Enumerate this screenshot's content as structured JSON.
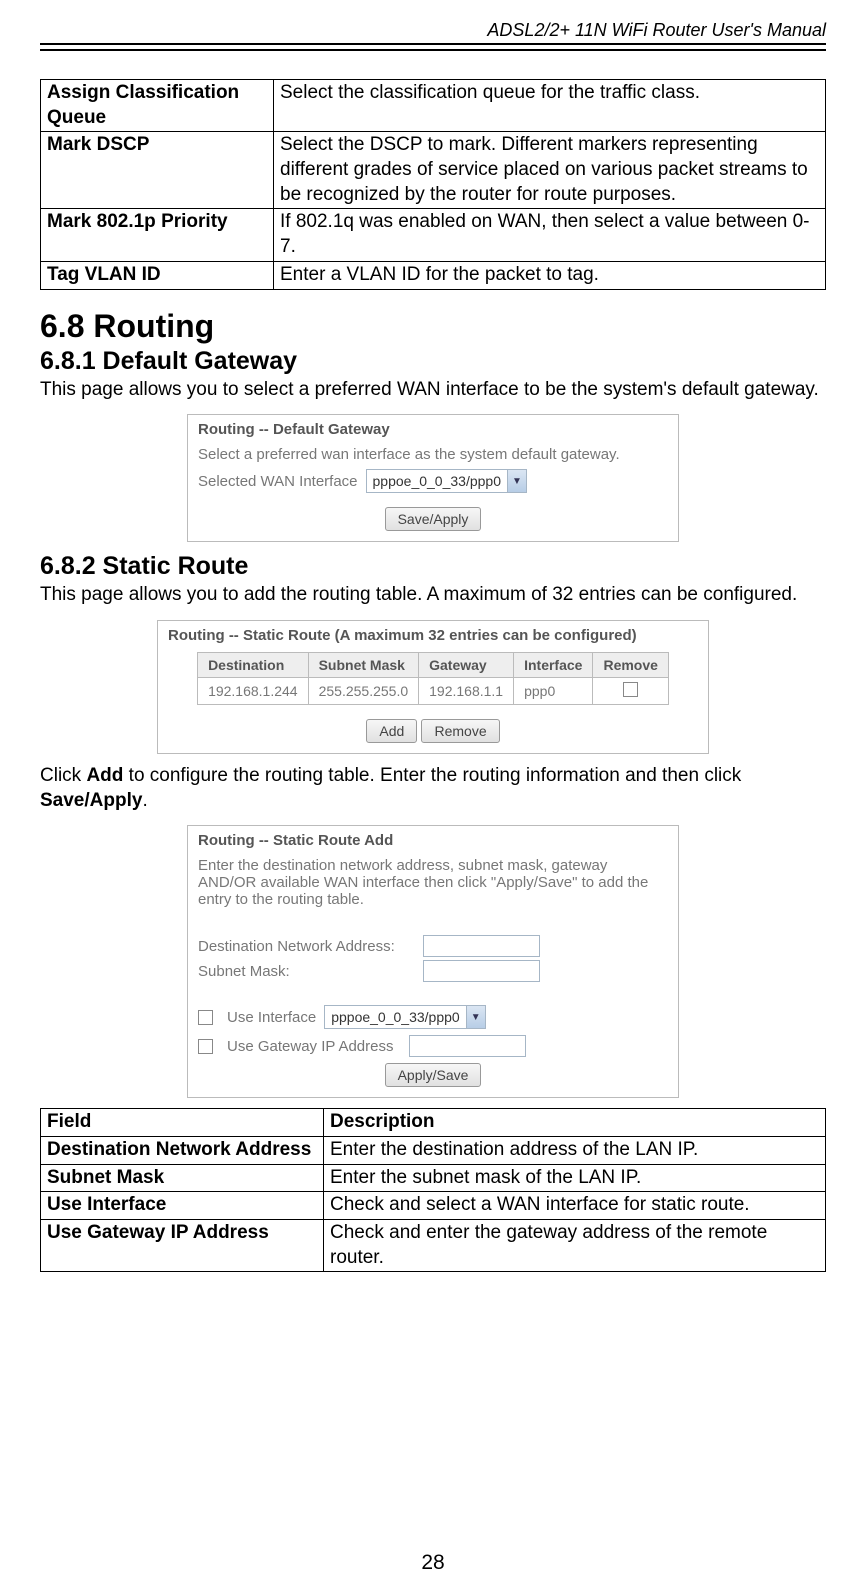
{
  "doc_header": "ADSL2/2+ 11N WiFi Router User's Manual",
  "table1": {
    "rows": [
      {
        "label": "Assign Classification Queue",
        "desc": "Select the classification queue for the traffic class."
      },
      {
        "label": "Mark DSCP",
        "desc": "Select the DSCP to mark. Different markers representing different grades of service placed on various packet streams to be recognized by the router for route purposes."
      },
      {
        "label": "Mark 802.1p Priority",
        "desc": "If 802.1q was enabled on WAN, then select a value between 0-7."
      },
      {
        "label": "Tag VLAN ID",
        "desc": "Enter a VLAN ID for the packet to tag."
      }
    ]
  },
  "sec68": "6.8   Routing",
  "sec681": "6.8.1 Default Gateway",
  "sec681_body": "This page allows you to select a preferred WAN interface to be the system's default gateway.",
  "panel_gw": {
    "title": "Routing -- Default Gateway",
    "text": "Select a preferred wan interface as the system default gateway.",
    "label": "Selected WAN Interface",
    "select": "pppoe_0_0_33/ppp0",
    "btn": "Save/Apply"
  },
  "sec682": "6.8.2 Static Route",
  "sec682_body": "This page allows you to add the routing table. A maximum of 32 entries can be configured.",
  "panel_sr": {
    "title": "Routing -- Static Route (A maximum 32 entries can be configured)",
    "headers": [
      "Destination",
      "Subnet Mask",
      "Gateway",
      "Interface",
      "Remove"
    ],
    "row": [
      "192.168.1.244",
      "255.255.255.0",
      "192.168.1.1",
      "ppp0"
    ],
    "btn_add": "Add",
    "btn_remove": "Remove"
  },
  "sr_instr_pre": "Click ",
  "sr_instr_add": "Add",
  "sr_instr_mid": " to configure the routing table. Enter the routing information and then click ",
  "sr_instr_save": "Save/Apply",
  "sr_instr_post": ".",
  "panel_add": {
    "title": "Routing -- Static Route Add",
    "text": "Enter the destination network address, subnet mask, gateway AND/OR available WAN interface then click \"Apply/Save\" to add the entry to the routing table.",
    "f_dest": "Destination Network Address:",
    "f_mask": "Subnet Mask:",
    "f_useif": "Use Interface",
    "sel_if": "pppoe_0_0_33/ppp0",
    "f_usegw": "Use Gateway IP Address",
    "btn": "Apply/Save"
  },
  "table2": {
    "h1": "Field",
    "h2": "Description",
    "rows": [
      {
        "label": "Destination Network Address",
        "desc": "Enter the destination address of the LAN IP."
      },
      {
        "label": "Subnet Mask",
        "desc": "Enter the subnet mask of the LAN IP."
      },
      {
        "label": "Use Interface",
        "desc": "Check and select a WAN interface for static route."
      },
      {
        "label": "Use Gateway IP Address",
        "desc": "Check and enter the gateway address of the remote router."
      }
    ]
  },
  "page_num": "28"
}
